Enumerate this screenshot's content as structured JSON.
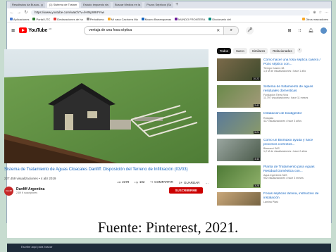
{
  "browser": {
    "tabs": [
      {
        "label": "Resultados da Busca - g",
        "active": false
      },
      {
        "label": "(1) Sistema de Tratam",
        "active": true
      },
      {
        "label": "Estudo impuesto sis",
        "active": false
      },
      {
        "label": "Buscar Medios en la",
        "active": false
      },
      {
        "label": "Pozos Sépticos (Su",
        "active": false
      }
    ],
    "url": "https://www.youtube.com/watch?v=lHrNpWKFrvw",
    "bookmarks": [
      "Aplicaciones",
      "Portal UTC",
      "Declaraciones de ha",
      "Periodismo",
      "Mi vaca Cachorra Ma",
      "Museo Barranqueras",
      "MUNDO FRONTERA",
      "Diccionario del",
      "Otros marcadores"
    ]
  },
  "youtube": {
    "logo_text": "YouTube",
    "logo_country": "AR",
    "search_query": "ventaja de una fosa séptica",
    "video": {
      "title": "Sistema de Tratamiento de Aguas Cloacales Danfiff: Disposición del Terreno de Infiltración (03/03)",
      "views_date": "227.459 visualizaciones • 4 abr 2019",
      "likes": "2379",
      "dislikes": "102",
      "share_label": "COMPARTIR",
      "save_label": "GUARDAR",
      "more_label": "…",
      "channel": "Danfiff Argentina",
      "subscribers": "2,89 K suscriptores",
      "subscribe_label": "SUSCRIBIRME"
    },
    "chips": [
      "Todos",
      "Sacro",
      "Similares",
      "Relacionados"
    ],
    "recommended": [
      {
        "title": "Cómo hacer una fosa séptica casera / Pozo séptico con...",
        "channel": "Tiempo Casero 38",
        "meta": "1,5 M de visualizaciones • hace 1 año",
        "duration": "10:22"
      },
      {
        "title": "Sistema de tratamiento de aguas residuales domesticas",
        "channel": "Fundación Tierra Viva",
        "meta": "11.797 visualizaciones • hace 11 meses",
        "duration": "2:41"
      },
      {
        "title": "Instalación de biodigestor",
        "channel": "Rotoplas",
        "meta": "427 visualizaciones • hace 3 años",
        "duration": "5:21"
      },
      {
        "title": "Como un Biomaxxi ayuda y hace procesos correctos...",
        "channel": "Biomaxxi SAS",
        "meta": "1,2 M de visualizaciones • hace 2 años",
        "duration": "4:43"
      },
      {
        "title": "Planta de Tratamiento para Aguas Residual Doméstica con...",
        "channel": "Aqua Ingeniería SAS",
        "meta": "902 visualizaciones • hace 3 meses",
        "duration": "3:28"
      },
      {
        "title": "Fosas sépticas lámina, instructivo de instalación",
        "channel": "Lámina Plast",
        "meta": "",
        "duration": ""
      }
    ]
  },
  "caption": "Fuente: Pinterest, 2021.",
  "taskbar_text": "Escribe aquí para buscar"
}
